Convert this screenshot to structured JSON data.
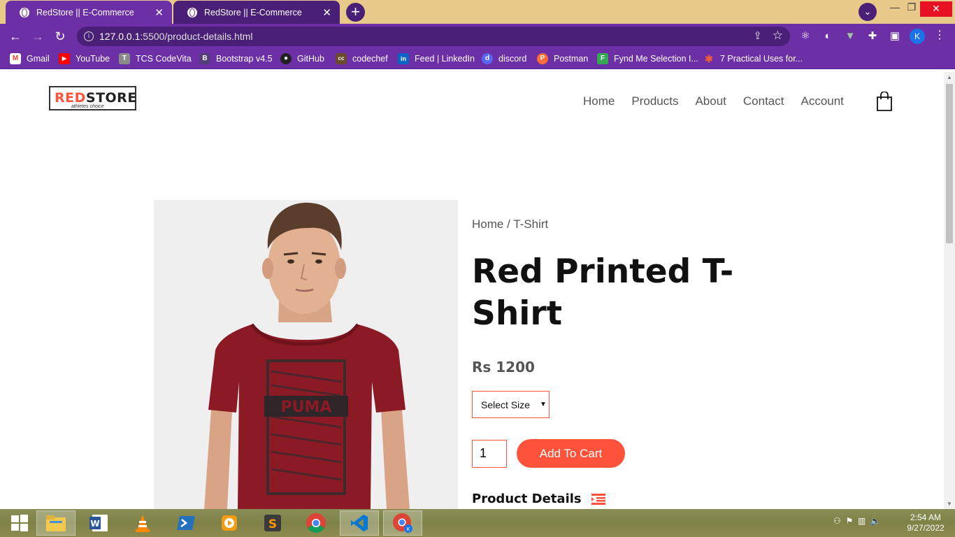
{
  "browser": {
    "tabs": [
      {
        "title": "RedStore || E-Commerce"
      },
      {
        "title": "RedStore || E-Commerce"
      }
    ],
    "url_host": "127.0.0.1",
    "url_path": ":5500/product-details.html",
    "profile_initial": "K",
    "bookmarks": [
      {
        "label": "Gmail",
        "icon_color": "#ea4335",
        "glyph": "M"
      },
      {
        "label": "YouTube",
        "icon_color": "#ff0000",
        "glyph": "▶"
      },
      {
        "label": "TCS CodeVita",
        "icon_color": "#8a8a8a",
        "glyph": "T"
      },
      {
        "label": "Bootstrap v4.5",
        "icon_color": "#563d7c",
        "glyph": "B"
      },
      {
        "label": "GitHub",
        "icon_color": "#222222",
        "glyph": "●"
      },
      {
        "label": "codechef",
        "icon_color": "#6b4a2b",
        "glyph": "cc"
      },
      {
        "label": "Feed | LinkedIn",
        "icon_color": "#0a66c2",
        "glyph": "in"
      },
      {
        "label": "discord",
        "icon_color": "#5865f2",
        "glyph": "d"
      },
      {
        "label": "Postman",
        "icon_color": "#ff6c37",
        "glyph": "P"
      },
      {
        "label": "Fynd Me Selection I...",
        "icon_color": "#34a853",
        "glyph": "F"
      },
      {
        "label": "7 Practical Uses for...",
        "icon_color": "#e85d3a",
        "glyph": "✱"
      }
    ]
  },
  "site": {
    "logo_red": "RED",
    "logo_dark": "STORE",
    "logo_tagline": "athletes choice",
    "nav": [
      "Home",
      "Products",
      "About",
      "Contact",
      "Account"
    ]
  },
  "product": {
    "breadcrumb": "Home / T-Shirt",
    "title": "Red Printed T-Shirt",
    "price": "Rs 1200",
    "size_select": "Select Size",
    "quantity": "1",
    "add_to_cart": "Add To Cart",
    "details_heading": "Product Details",
    "shirt_print": "PUMA"
  },
  "taskbar": {
    "time": "2:54 AM",
    "date": "9/27/2022"
  },
  "colors": {
    "accent": "#ff523b",
    "chrome_purple": "#6c2fa6",
    "tabbar_bg": "#e8c98a",
    "shirt_red": "#8b1a24"
  }
}
